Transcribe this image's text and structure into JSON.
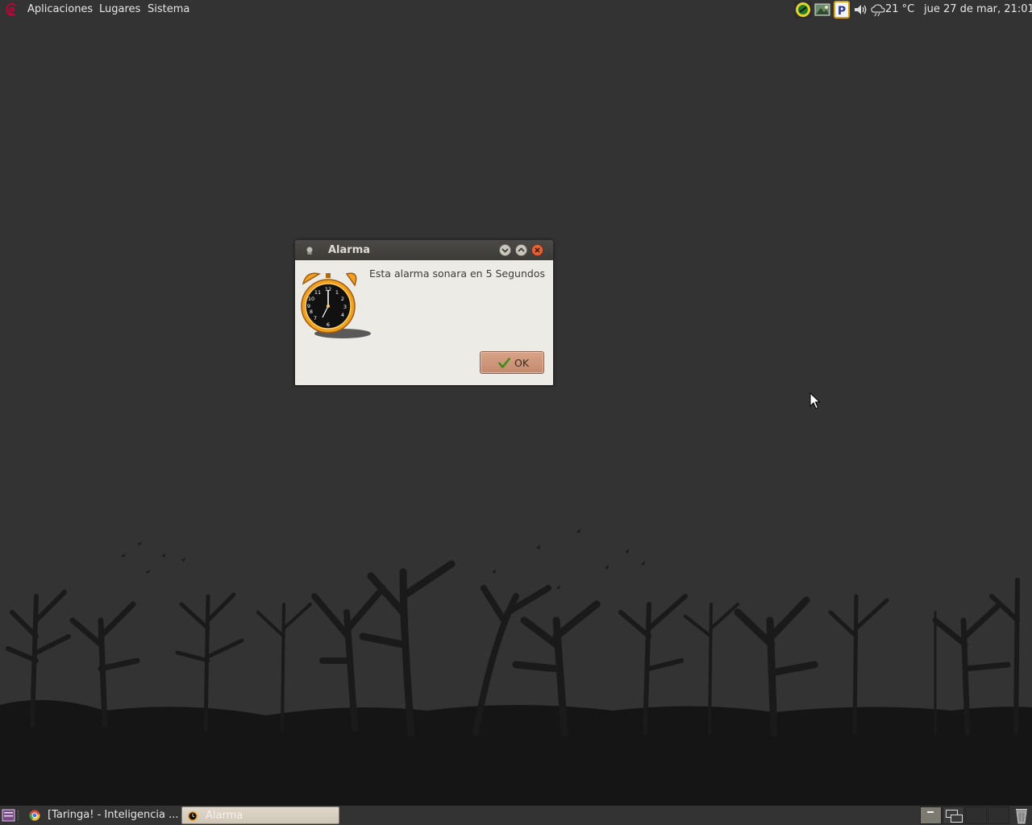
{
  "top_panel": {
    "menus": [
      "Aplicaciones",
      "Lugares",
      "Sistema"
    ],
    "weather": "21 °C",
    "clock": "jue 27 de mar, 21:01",
    "tray_icons": [
      "network-icon",
      "image-viewer-icon",
      "parking-icon",
      "volume-icon",
      "weather-icon"
    ]
  },
  "dialog": {
    "title": "Alarma",
    "message": "Esta alarma sonara en 5 Segundos",
    "ok_label": "OK"
  },
  "taskbar": {
    "tasks": [
      {
        "label": "[Taringa! - Inteligencia ...",
        "icon": "chrome-icon",
        "active": false
      },
      {
        "label": "Alarma",
        "icon": "alarm-clock-icon",
        "active": true
      }
    ],
    "workspaces": 4
  },
  "colors": {
    "panel": "#333333",
    "dialog_bg": "#edebe5",
    "titlebar": "#3c3b37",
    "close_button": "#e0643a",
    "ok_button": "#c9917a",
    "clock_face": "#111111",
    "alarm_body": "#f0a020",
    "debian_logo": "#c7003b"
  }
}
